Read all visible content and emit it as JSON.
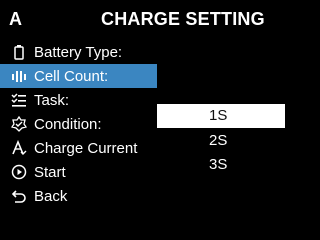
{
  "header": {
    "left_label": "A",
    "title": "CHARGE SETTING"
  },
  "menu": {
    "items": [
      {
        "label": "Battery Type:",
        "icon": "battery-icon"
      },
      {
        "label": "Cell Count:",
        "icon": "cell-count-icon",
        "selected": true
      },
      {
        "label": "Task:",
        "icon": "task-list-icon"
      },
      {
        "label": "Condition:",
        "icon": "condition-icon"
      },
      {
        "label": "Charge Current",
        "icon": "charge-current-icon"
      },
      {
        "label": "Start",
        "icon": "play-icon"
      },
      {
        "label": "Back",
        "icon": "back-arrow-icon"
      }
    ]
  },
  "dropdown": {
    "options": [
      "1S",
      "2S",
      "3S"
    ],
    "selected": "1S"
  },
  "colors": {
    "highlight": "#3b86c1",
    "background": "#000000",
    "text": "#ffffff"
  }
}
